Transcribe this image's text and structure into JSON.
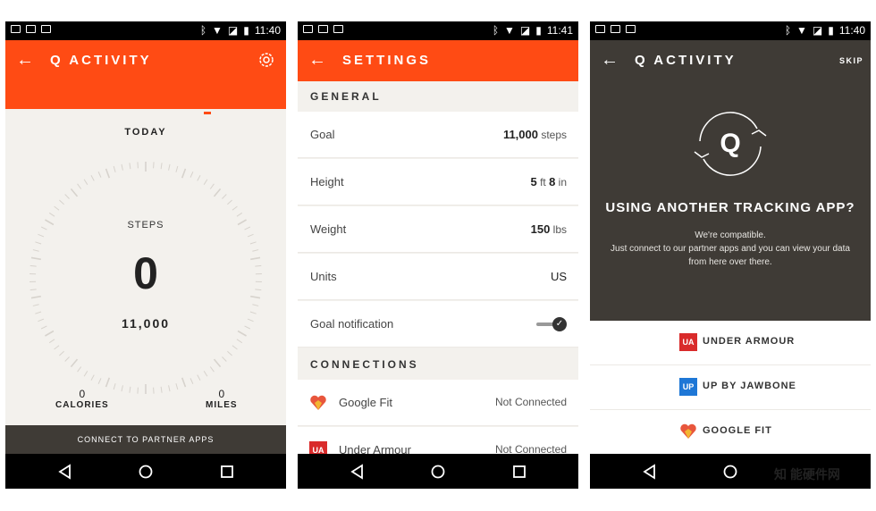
{
  "status": {
    "time_1": "11:40",
    "time_2": "11:41",
    "time_3": "11:40"
  },
  "screen1": {
    "title": "Q ACTIVITY",
    "today": "TODAY",
    "steps_label": "STEPS",
    "steps_value": "0",
    "goal": "11,000",
    "calories_value": "0",
    "calories_label": "CALORIES",
    "miles_value": "0",
    "miles_label": "MILES",
    "connect_label": "CONNECT TO PARTNER APPS"
  },
  "screen2": {
    "title": "SETTINGS",
    "general_header": "GENERAL",
    "rows": [
      {
        "label": "Goal",
        "value_num": "11,000",
        "value_unit": " steps"
      },
      {
        "label": "Height",
        "value_num": "5",
        "value_unit": " ft ",
        "value_num2": "8",
        "value_unit2": " in"
      },
      {
        "label": "Weight",
        "value_num": "150",
        "value_unit": " lbs"
      },
      {
        "label": "Units",
        "value_num": "US",
        "value_unit": ""
      }
    ],
    "goal_notification": "Goal notification",
    "toggle_on": true,
    "connections_header": "CONNECTIONS",
    "connections": [
      {
        "name": "Google Fit",
        "status": "Not Connected"
      },
      {
        "name": "Under Armour",
        "status": "Not Connected"
      }
    ]
  },
  "screen3": {
    "title": "Q ACTIVITY",
    "skip": "SKIP",
    "logo_letter": "Q",
    "headline": "USING ANOTHER TRACKING APP?",
    "line1": "We're compatible.",
    "line2": "Just connect to our partner apps and you can view your data from here over there.",
    "partners": [
      {
        "name": "UNDER ARMOUR",
        "icon": "UA"
      },
      {
        "name": "UP BY JAWBONE",
        "icon": "UP"
      },
      {
        "name": "GOOGLE FIT",
        "icon": "heart"
      }
    ]
  },
  "watermark": "知 能硬件网",
  "colors": {
    "accent": "#ff4b14",
    "dark": "#3f3b36",
    "background": "#f3f1ed"
  }
}
